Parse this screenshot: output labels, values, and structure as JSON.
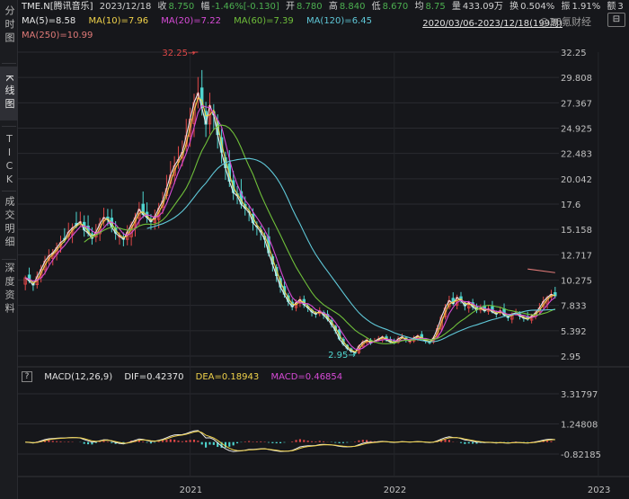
{
  "sidebar": {
    "tabs": [
      {
        "label": "分时图",
        "active": false
      },
      {
        "label": "K线图",
        "active": true
      },
      {
        "label": "TICK",
        "active": false
      },
      {
        "label": "成交明细",
        "active": false
      },
      {
        "label": "深度资料",
        "active": false
      }
    ]
  },
  "quote": {
    "symbol": "TME.N[腾讯音乐]",
    "date": "2023/12/18",
    "close_label": "收",
    "close": "8.750",
    "change_label": "幅",
    "change": "-1.46%[-0.130]",
    "open_label": "开",
    "open": "8.780",
    "high_label": "高",
    "high": "8.840",
    "low_label": "低",
    "low": "8.670",
    "avg_label": "均",
    "avg": "8.75",
    "volume_label": "量",
    "volume": "433.09万",
    "turnover_label": "换",
    "turnover": "0.504%",
    "amplitude_label": "振",
    "amplitude": "1.91%",
    "amount_label": "额",
    "amount": "3"
  },
  "ma": [
    {
      "label": "MA(5)=8.58",
      "color": "#e8e8e8"
    },
    {
      "label": "MA(10)=7.96",
      "color": "#f0d24a"
    },
    {
      "label": "MA(20)=7.22",
      "color": "#d84bd8"
    },
    {
      "label": "MA(60)=7.39",
      "color": "#6fbf3a"
    },
    {
      "label": "MA(120)=6.45",
      "color": "#5fc8d8"
    },
    {
      "label": "MA(250)=10.99",
      "color": "#e07a78"
    }
  ],
  "range_label": "2020/03/06-2023/12/18(199周)",
  "watermark": "@36氪财经",
  "settings_icon": "⊟",
  "price_axis": [
    "32.25",
    "29.808",
    "27.367",
    "24.925",
    "22.483",
    "20.042",
    "17.6",
    "15.158",
    "12.717",
    "10.275",
    "7.833",
    "5.392",
    "2.95"
  ],
  "annotations": {
    "high": "32.25",
    "low": "2.95"
  },
  "macd": {
    "help_icon": "?",
    "title": "MACD(12,26,9)",
    "dif": "DIF=0.42370",
    "dea": "DEA=0.18943",
    "macd": "MACD=0.46854",
    "dif_color": "#e8e8e8",
    "dea_color": "#f0d24a",
    "macd_color": "#d84bd8",
    "axis": [
      "3.31797",
      "1.24808",
      "-0.82185"
    ]
  },
  "x_axis": [
    "2021",
    "2022",
    "2023"
  ],
  "chart_data": {
    "type": "candlestick",
    "title": "TME.N[腾讯音乐]",
    "period": "weekly",
    "range": "2020/03/06-2023/12/18",
    "ylim": [
      2.95,
      32.25
    ],
    "x_ticks": [
      "2021",
      "2022",
      "2023"
    ],
    "approx_weekly_close": [
      10.5,
      10.2,
      9.8,
      10.6,
      11.3,
      12.1,
      12.6,
      12.9,
      13.4,
      13.9,
      14.2,
      14.9,
      15.3,
      15.6,
      15.9,
      15.1,
      14.8,
      14.3,
      14.9,
      15.7,
      16.3,
      16.1,
      15.4,
      14.8,
      14.5,
      14.2,
      14.9,
      15.6,
      16.3,
      17.1,
      16.6,
      16.3,
      15.9,
      16.4,
      17.2,
      17.9,
      19.1,
      20.4,
      21.3,
      21.9,
      22.6,
      24.2,
      25.8,
      27.4,
      28.3,
      26.9,
      25.3,
      27.1,
      26.2,
      24.3,
      22.6,
      21.1,
      19.8,
      18.7,
      18.4,
      17.6,
      17.2,
      16.8,
      15.8,
      15.4,
      14.9,
      14.2,
      12.9,
      11.8,
      10.7,
      9.6,
      8.9,
      8.2,
      7.7,
      8.1,
      8.4,
      7.9,
      7.6,
      7.2,
      7.0,
      7.3,
      6.9,
      6.5,
      6.0,
      5.4,
      4.6,
      4.1,
      3.7,
      3.4,
      3.3,
      3.9,
      4.3,
      4.5,
      4.2,
      4.4,
      4.6,
      4.8,
      4.5,
      4.3,
      4.2,
      4.6,
      4.8,
      4.5,
      4.4,
      4.7,
      4.9,
      4.6,
      4.4,
      4.3,
      4.7,
      5.6,
      6.7,
      7.6,
      8.3,
      8.0,
      8.6,
      8.3,
      7.8,
      8.1,
      7.7,
      7.4,
      7.6,
      7.3,
      7.5,
      7.2,
      7.0,
      7.3,
      6.9,
      6.7,
      7.0,
      7.1,
      6.8,
      6.6,
      6.5,
      6.8,
      7.1,
      7.6,
      8.2,
      8.6,
      8.9,
      8.75
    ],
    "series": [
      {
        "name": "MA(5)",
        "last": 8.58
      },
      {
        "name": "MA(10)",
        "last": 7.96
      },
      {
        "name": "MA(20)",
        "last": 7.22
      },
      {
        "name": "MA(60)",
        "last": 7.39
      },
      {
        "name": "MA(120)",
        "last": 6.45
      },
      {
        "name": "MA(250)",
        "last": 10.99
      }
    ],
    "macd": {
      "dif": 0.4237,
      "dea": 0.18943,
      "macd": 0.46854,
      "ylim": [
        -0.82185,
        3.31797
      ]
    }
  }
}
